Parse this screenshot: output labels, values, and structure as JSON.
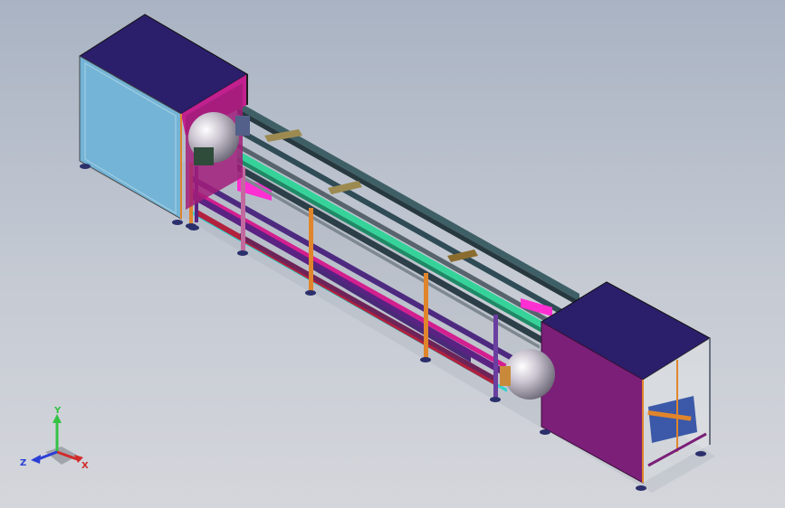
{
  "viewport": {
    "background_top": "#a9b3c3",
    "background_bottom": "#d4d6db"
  },
  "model": {
    "colors": {
      "cabinet_top": "#2b1f6b",
      "cabinet_left_side": "#74b4d6",
      "cabinet_right_side": "#7b1f78",
      "frame_edge": "#6a7180",
      "rail_green": "#35d39a",
      "rail_dark": "#2f4b56",
      "beam_magenta": "#c8208e",
      "beam_purple": "#5a2283",
      "post_orange": "#e0852c",
      "post_purple": "#6b3fa0",
      "accent_cyan": "#3ad2cc",
      "chrome": "#c9c3cf"
    }
  },
  "triad": {
    "y_label": "Y",
    "z_label": "Z",
    "x_label": "X",
    "y_color": "#35c245",
    "z_color": "#2b3fd6",
    "x_color": "#d22b2b"
  }
}
